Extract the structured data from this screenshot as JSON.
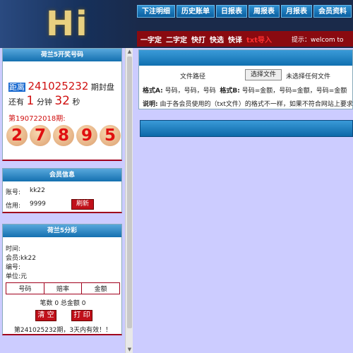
{
  "header": {
    "logo": "Hi",
    "nav": [
      "下注明细",
      "历史账单",
      "日报表",
      "周报表",
      "月报表",
      "会员资料"
    ],
    "plays": [
      "一字定",
      "二字定",
      "快打",
      "快选",
      "快译"
    ],
    "txt_import": "txt导入",
    "notice": "提示：welcom to"
  },
  "draw_panel": {
    "title": "荷兰5开奖号码",
    "distance_label": "距离",
    "period": "241025232",
    "close_suffix": "期封盘",
    "remain_prefix": "还有",
    "minutes": "1",
    "min_unit": "分钟",
    "seconds": "32",
    "sec_unit": "秒",
    "last_period": "第190722018期:",
    "numbers": [
      "2",
      "7",
      "8",
      "9",
      "5"
    ]
  },
  "member_panel": {
    "title": "会员信息",
    "account_label": "账号:",
    "account": "kk22",
    "credit_label": "信用:",
    "credit": "9999",
    "refresh": "刷新"
  },
  "bet_panel": {
    "title": "荷兰5分彩",
    "time_label": "时间:",
    "member_label": "会员:",
    "member": "kk22",
    "code_label": "编号:",
    "unit_label": "单位:",
    "unit": "元",
    "columns": [
      "号码",
      "赔率",
      "金额"
    ],
    "summary": "笔数 0 总金额 0",
    "clear": "清 空",
    "print": "打 印",
    "expire": "第241025232期，3天内有效！！"
  },
  "import_panel": {
    "path_label": "文件路径",
    "choose_file": "选择文件",
    "no_file": "未选择任何文件",
    "format_a_label": "格式A:",
    "format_a": "号码，号码，号码",
    "format_b_label": "格式B:",
    "format_b": "号码=金额，号码=金额，号码=金额",
    "note_label": "说明:",
    "note": "由于各会员使用的（txt文件）的格式不一样，如果不符合网站上要求"
  }
}
